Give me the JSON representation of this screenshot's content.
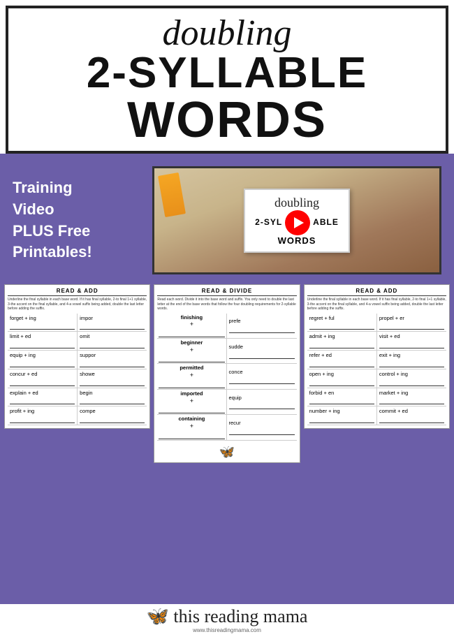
{
  "header": {
    "line1": "doubling",
    "line2": "2-SYLLABLE",
    "line3": "WORDS"
  },
  "middle": {
    "training_text_line1": "Training",
    "training_text_line2": "Video",
    "training_text_line3": "PLUS Free",
    "training_text_line4": "Printables!",
    "video_card_title1": "doubling",
    "video_card_title2_line1": "2-SYLLABLE",
    "video_card_title2_line2": "WORDS"
  },
  "worksheet_left": {
    "title": "READ & ADD",
    "subtitle": "Underline the final syllable in each base word. If it has final syllable, 2-to final 1+1 syllable, 3-the accent on the final syllable, and 4-a vowel suffix being added, double the last letter before adding the suffix.",
    "rows": [
      [
        "forget + ing",
        "impor"
      ],
      [
        "limit + ed",
        "omit"
      ],
      [
        "equip + ing",
        "suppor"
      ],
      [
        "concur + ed",
        "showe"
      ],
      [
        "explain + ed",
        "begin"
      ],
      [
        "profit + ing",
        "compe"
      ]
    ]
  },
  "worksheet_middle": {
    "title": "READ & DIVIDE",
    "subtitle": "Read each word. Divide it into the base word and suffix. You only need to double the last letter at the end of the base words that follow the four doubling requirements for 2-syllable words.",
    "words": [
      "finishing",
      "beginner",
      "permitted",
      "imported",
      "containing"
    ],
    "suffixes": [
      "prefe",
      "sudde",
      "conce",
      "equip",
      "recur"
    ]
  },
  "worksheet_right": {
    "title": "READ & ADD",
    "subtitle": "Underline the final syllable in each base word. If it has final syllable, 2-to final 1+1 syllable, 3-the accent on the final syllable, and 4-a vowel suffix being added, double the last letter before adding the suffix.",
    "rows": [
      [
        "regret + ful",
        "propel + er"
      ],
      [
        "admit + ing",
        "visit + ed"
      ],
      [
        "refer + ed",
        "exit + ing"
      ],
      [
        "open + ing",
        "control + ing"
      ],
      [
        "forbid + en",
        "market + ing"
      ],
      [
        "number + ing",
        "commit + ed"
      ]
    ]
  },
  "footer": {
    "text": "this reading mama",
    "url": "www.thisreadingmama.com"
  }
}
